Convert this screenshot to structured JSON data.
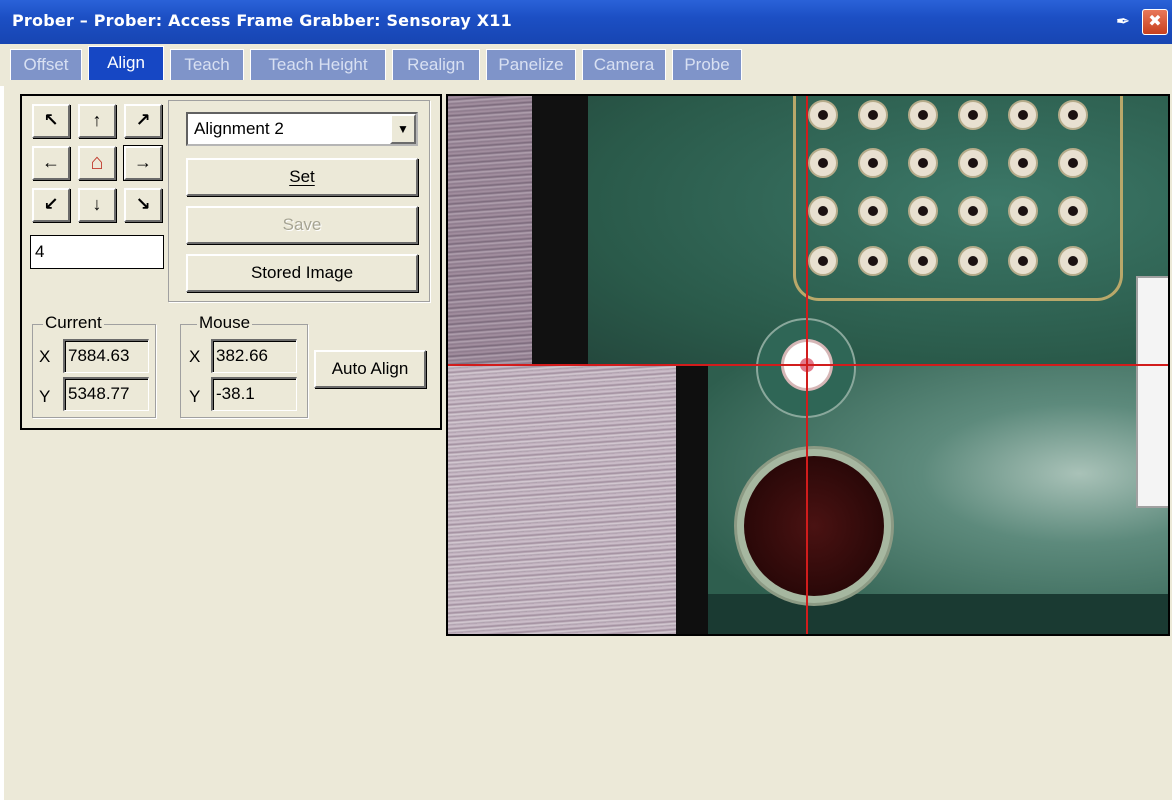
{
  "window": {
    "title": "Prober – Prober: Access Frame Grabber: Sensoray X11",
    "pin_icon": "✒",
    "close_glyph": "✖"
  },
  "tabs": [
    {
      "label": "Offset",
      "active": false
    },
    {
      "label": "Align",
      "active": true
    },
    {
      "label": "Teach",
      "active": false
    },
    {
      "label": "Teach Height",
      "active": false
    },
    {
      "label": "Realign",
      "active": false
    },
    {
      "label": "Panelize",
      "active": false
    },
    {
      "label": "Camera",
      "active": false
    },
    {
      "label": "Probe",
      "active": false
    }
  ],
  "jog": {
    "icons": {
      "up_left": "↖",
      "up": "↑",
      "up_right": "↗",
      "left": "←",
      "home": "⌂",
      "right": "→",
      "down_left": "↙",
      "down": "↓",
      "down_right": "↘"
    },
    "step_value": "4"
  },
  "alignment": {
    "selected": "Alignment 2",
    "dropdown_glyph": "▼",
    "set_label": "Set",
    "save_label": "Save",
    "stored_image_label": "Stored Image",
    "auto_align_label": "Auto Align"
  },
  "current": {
    "legend": "Current",
    "x_label": "X",
    "y_label": "Y",
    "x_value": "7884.63",
    "y_value": "5348.77"
  },
  "mouse": {
    "legend": "Mouse",
    "x_label": "X",
    "y_label": "Y",
    "x_value": "382.66",
    "y_value": "-38.1"
  },
  "colors": {
    "titlebar": "#1c4fc4",
    "active_tab": "#1647c4",
    "inactive_tab": "#7f94c9",
    "window_bg": "#ece9d8",
    "crosshair": "#d21c1c"
  }
}
